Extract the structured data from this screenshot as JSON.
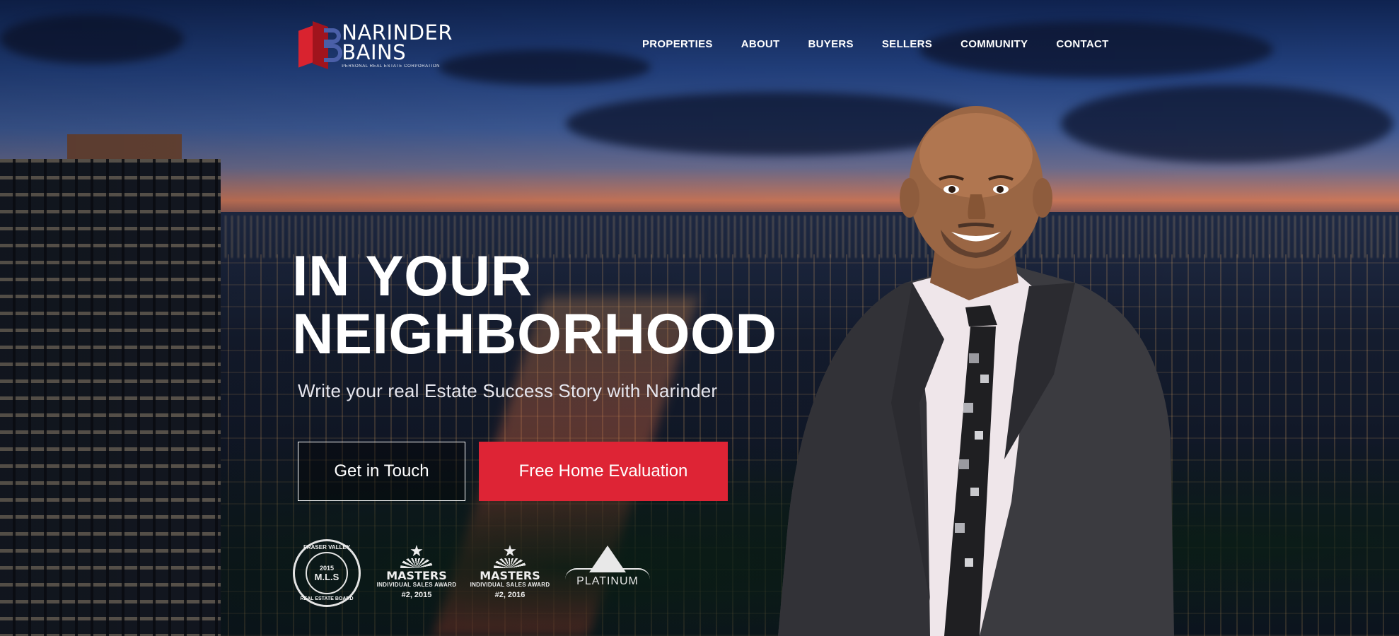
{
  "brand": {
    "name_line1": "NARINDER",
    "name_line2": "BAINS",
    "tagline": "PERSONAL REAL ESTATE CORPORATION",
    "primary_red": "#de2435",
    "logo_blue": "#4a5fa8"
  },
  "nav": {
    "items": [
      {
        "label": "PROPERTIES"
      },
      {
        "label": "ABOUT"
      },
      {
        "label": "BUYERS"
      },
      {
        "label": "SELLERS"
      },
      {
        "label": "COMMUNITY"
      },
      {
        "label": "CONTACT"
      }
    ]
  },
  "hero": {
    "headline_line1": "IN YOUR",
    "headline_line2": "NEIGHBORHOOD",
    "subheadline": "Write your real Estate Success Story with Narinder",
    "cta_primary": "Get in Touch",
    "cta_secondary": "Free Home Evaluation"
  },
  "awards": {
    "seal": {
      "top_text": "FRASER VALLEY",
      "year": "2015",
      "center": "M.L.S",
      "bottom_text": "REAL ESTATE BOARD"
    },
    "masters_2015": {
      "title": "MASTERS",
      "subtitle": "INDIVIDUAL SALES AWARD",
      "rank": "#2, 2015"
    },
    "masters_2016": {
      "title": "MASTERS",
      "subtitle": "INDIVIDUAL SALES AWARD",
      "rank": "#2, 2016"
    },
    "platinum": {
      "label": "PLATINUM"
    }
  },
  "icons": {
    "logo": "nb-monogram-icon",
    "award_star": "star-icon",
    "platinum": "diamond-icon"
  }
}
